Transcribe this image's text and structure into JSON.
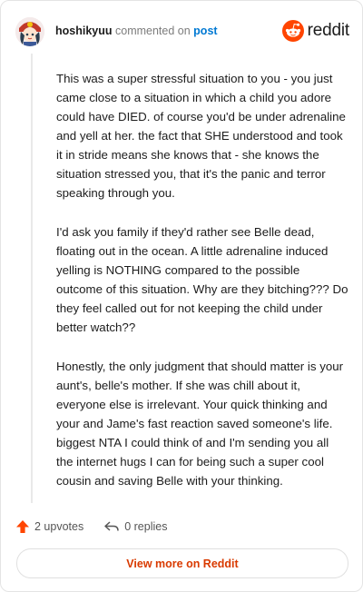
{
  "comment": {
    "username": "hoshikyuu",
    "action_text": "commented on",
    "post_link": "post",
    "paragraphs": [
      "This was a super stressful situation to you - you just came close to a situation in which a child you adore could have DIED. of course you'd be under adrenaline and yell at her. the fact that SHE understood and took it in stride means she knows that - she knows the situation stressed you, that it's the panic and terror speaking through you.",
      "I'd ask you family if they'd rather see Belle dead, floating out in the ocean. A little adrenaline induced yelling is NOTHING compared to the possible outcome of this situation. Why are they bitching??? Do they feel called out for not keeping the child under better watch??",
      "Honestly, the only judgment that should matter is your aunt's, belle's mother. If she was chill about it, everyone else is irrelevant. Your quick thinking and your and Jame's fast reaction saved someone's life. biggest NTA I could think of and I'm sending you all the internet hugs I can for being such a super cool cousin and saving Belle with your thinking."
    ]
  },
  "brand": {
    "wordmark": "reddit",
    "color": "#ff4500"
  },
  "actions": {
    "upvotes": "2 upvotes",
    "replies": "0 replies"
  },
  "footer": {
    "view_more": "View more on Reddit"
  },
  "colors": {
    "accent": "#ff4500",
    "link": "#0079d3",
    "button_text": "#d93a00"
  },
  "icons": {
    "upvote": "upvote-arrow-icon",
    "reply": "reply-arrow-icon",
    "logo": "reddit-snoo-icon"
  }
}
